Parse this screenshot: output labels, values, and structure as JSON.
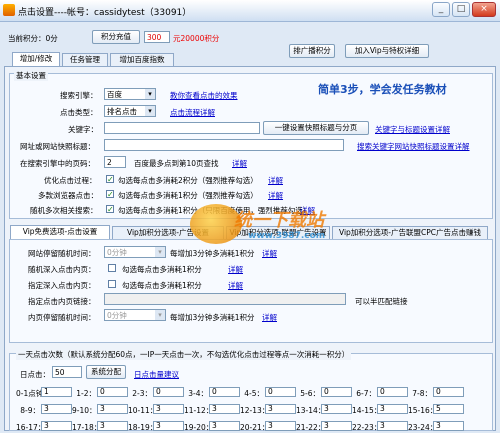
{
  "window": {
    "title": "点击设置----帐号：cassidytest（33091）",
    "minimize": "_",
    "maximize": "□",
    "close": "×"
  },
  "topbar": {
    "score_label": "当前积分：0分",
    "recharge_button": "积分充值",
    "recharge_amount": "300",
    "recharge_note": "元20000积分",
    "rank_button": "排广播积分",
    "join_vip_button": "加入Vip与特权详细"
  },
  "tabs": [
    "增加/修改",
    "任务管理",
    "增加百度指数"
  ],
  "basic": {
    "legend": "基本设置",
    "promo": "简单3步，学会发任务教材",
    "engine_label": "搜索引擎：",
    "engine_value": "百度",
    "engine_link": "教你查看点击的效果",
    "click_type_label": "点击类型：",
    "click_type_value": "排名点击",
    "click_type_link": "点击流程详解",
    "keyword_label": "关键字：",
    "keyword_button": "一键设置快照标题与分页",
    "keyword_link": "关键字与标题设置详解",
    "url_label": "网址或网站快照标题：",
    "url_link": "搜索关键字网站快照标题设置详解",
    "pages_label": "在搜索引擎中的页码：",
    "pages_value": "2",
    "pages_note": "百度最多点到第10页查找",
    "pages_link": "详解",
    "opt1_label": "优化点击过程：",
    "opt1_text": "勾选每点击多消耗2积分（强烈推荐勾选）",
    "opt1_link": "详解",
    "opt2_label": "多款浏览器点击：",
    "opt2_text": "勾选每点击多消耗1积分（强烈推荐勾选）",
    "opt2_link": "详解",
    "opt3_label": "随机多次相关搜索：",
    "opt3_text": "勾选每点击多消耗1积分（只限百度使用，强烈推荐勾选）",
    "opt3_link": "详解"
  },
  "vip_tabs": [
    "Vip免费选项-点击设置",
    "Vip加积分选项-广告设置",
    "Vip加积分选项-联盟广告设置",
    "Vip加积分选项-广告联盟CPC广告点击赚钱"
  ],
  "vip": {
    "stay_label": "网站停留随机时间：",
    "stay_value": "0分钟",
    "stay_note": "每增加3分钟多消耗1积分",
    "stay_link": "详解",
    "random_in_label": "随机深入点击内页：",
    "random_in_text": "勾选每点击多消耗1积分",
    "random_in_link": "详解",
    "fixed_in_label": "指定深入点击内页：",
    "fixed_in_text": "勾选每点击多消耗1积分",
    "fixed_in_link": "详解",
    "fixed_link_label": "指定点击内页链接：",
    "fixed_link_note": "可以半匹配链接",
    "inner_stay_label": "内页停留随机时间：",
    "inner_stay_value": "0分钟",
    "inner_stay_note": "每增加3分钟多消耗1积分",
    "inner_stay_link": "详解"
  },
  "watermark": {
    "text": "统一下载站",
    "url": "www.3987.com"
  },
  "daily": {
    "legend": "一天点击次数（默认系统分配60点，一IP一天点击一次，不勾选优化点击过程等点一次消耗一积分）",
    "day_label": "日点击：",
    "day_value": "50",
    "assign_button": "系统分配",
    "assign_link": "日点击量建议",
    "hours_row1": [
      "0-1点钟：",
      "1-2：",
      "2-3：",
      "3-4：",
      "4-5：",
      "5-6：",
      "6-7：",
      "7-8："
    ],
    "hours_row2": [
      "8-9：",
      "9-10：",
      "10-11：",
      "11-12：",
      "12-13：",
      "13-14：",
      "14-15：",
      "15-16："
    ],
    "hours_row3": [
      "16-17：",
      "17-18：",
      "18-19：",
      "19-20：",
      "20-21：",
      "21-22：",
      "22-23：",
      "23-24："
    ],
    "vals_row1": [
      "1",
      "0",
      "0",
      "0",
      "0",
      "0",
      "0",
      "0"
    ],
    "vals_row2": [
      "3",
      "3",
      "3",
      "3",
      "3",
      "3",
      "3",
      "5"
    ],
    "vals_row3": [
      "3",
      "3",
      "3",
      "3",
      "3",
      "3",
      "3",
      "3"
    ]
  }
}
